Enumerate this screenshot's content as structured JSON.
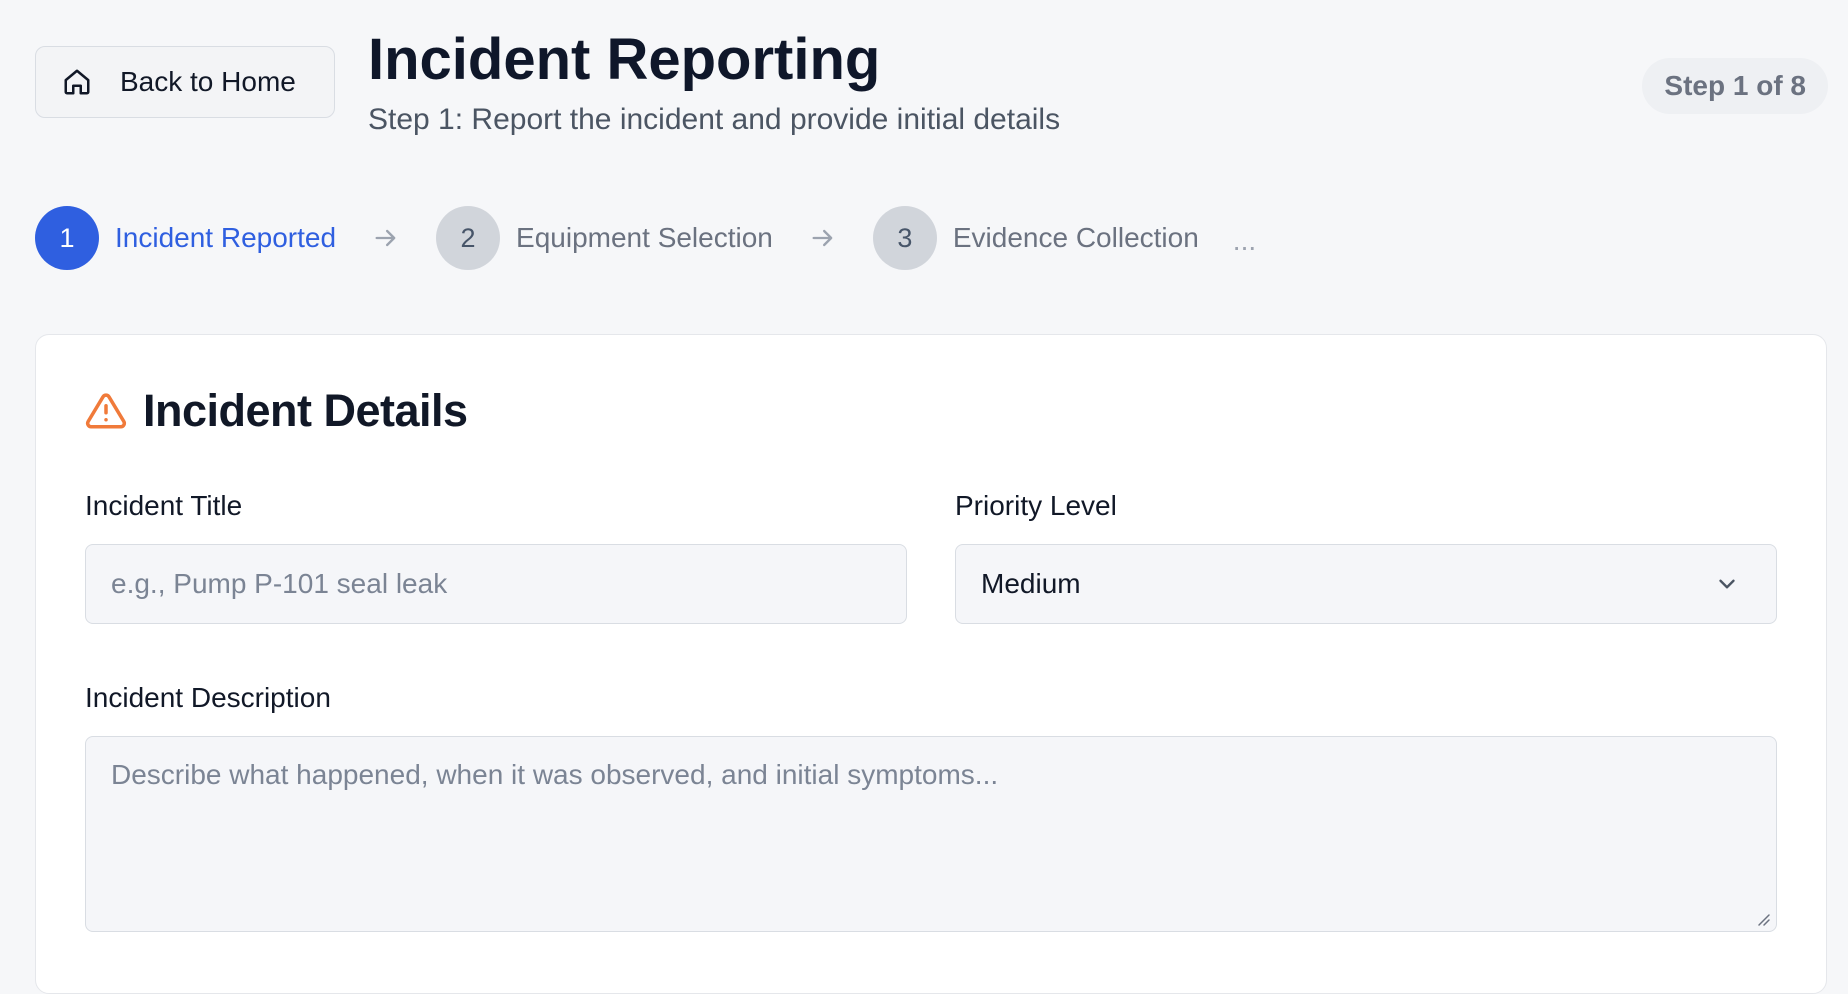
{
  "header": {
    "back_label": "Back to Home",
    "back_icon": "home-icon",
    "title": "Incident Reporting",
    "subtitle": "Step 1: Report the incident and provide initial details",
    "step_badge": "Step 1 of 8"
  },
  "stepper": {
    "steps": [
      {
        "number": "1",
        "label": "Incident Reported",
        "state": "active"
      },
      {
        "number": "2",
        "label": "Equipment Selection",
        "state": "upcoming"
      },
      {
        "number": "3",
        "label": "Evidence Collection",
        "state": "upcoming"
      }
    ],
    "more": "..."
  },
  "card": {
    "title": "Incident Details",
    "title_icon": "warning-triangle-icon",
    "incident_title": {
      "label": "Incident Title",
      "placeholder": "e.g., Pump P-101 seal leak",
      "value": ""
    },
    "priority": {
      "label": "Priority Level",
      "value": "Medium"
    },
    "description": {
      "label": "Incident Description",
      "placeholder": "Describe what happened, when it was observed, and initial symptoms...",
      "value": ""
    }
  },
  "colors": {
    "accent": "#2f5fe0",
    "warning": "#f07a3a",
    "background": "#f6f7f9"
  }
}
